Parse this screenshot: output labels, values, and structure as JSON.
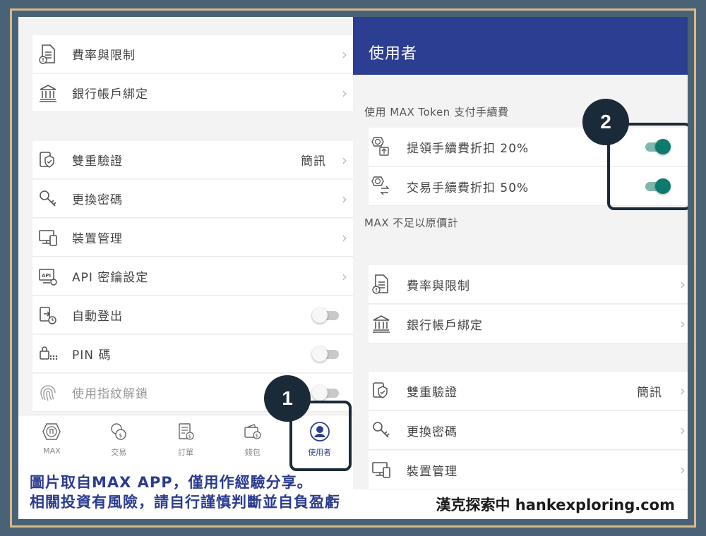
{
  "left": {
    "menu_group1": [
      {
        "label": "費率與限制",
        "icon": "document-icon"
      },
      {
        "label": "銀行帳戶綁定",
        "icon": "bank-icon"
      }
    ],
    "menu_group2": [
      {
        "label": "雙重驗證",
        "value": "簡訊",
        "icon": "two-factor-icon"
      },
      {
        "label": "更換密碼",
        "icon": "key-icon"
      },
      {
        "label": "裝置管理",
        "icon": "device-icon"
      },
      {
        "label": "API 密鑰設定",
        "icon": "api-icon"
      },
      {
        "label": "自動登出",
        "icon": "auto-logout-icon",
        "toggle": false
      },
      {
        "label": "PIN 碼",
        "icon": "pin-lock-icon",
        "toggle": false
      },
      {
        "label": "使用指紋解鎖",
        "icon": "fingerprint-icon",
        "toggle": false
      }
    ],
    "tabs": [
      {
        "label": "MAX",
        "icon": "max-coin-icon"
      },
      {
        "label": "交易",
        "icon": "exchange-icon"
      },
      {
        "label": "訂單",
        "icon": "orders-icon"
      },
      {
        "label": "錢包",
        "icon": "wallet-icon"
      },
      {
        "label": "使用者",
        "icon": "user-icon",
        "active": true
      }
    ]
  },
  "right": {
    "title": "使用者",
    "fee_section_label": "使用 MAX Token 支付手續費",
    "fee_toggles": [
      {
        "label": "提領手續費折扣 20%",
        "icon": "withdraw-discount-icon",
        "toggle": true
      },
      {
        "label": "交易手續費折扣 50%",
        "icon": "trade-discount-icon",
        "toggle": true
      }
    ],
    "fee_note": "MAX 不足以原價計",
    "menu_group1": [
      {
        "label": "費率與限制",
        "icon": "document-icon"
      },
      {
        "label": "銀行帳戶綁定",
        "icon": "bank-icon"
      }
    ],
    "menu_group2": [
      {
        "label": "雙重驗證",
        "value": "簡訊",
        "icon": "two-factor-icon"
      },
      {
        "label": "更換密碼",
        "icon": "key-icon"
      },
      {
        "label": "裝置管理",
        "icon": "device-icon"
      }
    ]
  },
  "annotations": {
    "badge1": "1",
    "badge2": "2"
  },
  "caption": {
    "line1": "圖片取自MAX APP，僅用作經驗分享。",
    "line2": "相關投資有風險，請自行謹慎判斷並自負盈虧",
    "credit": "漢克探索中 hankexploring.com"
  },
  "colors": {
    "header": "#2c3e91",
    "toggle_on": "#0d7b6c",
    "annotation": "#1b2a38",
    "frame": "#4a6275",
    "frame_border": "#d8b98a",
    "caption": "#2b3c8f"
  }
}
